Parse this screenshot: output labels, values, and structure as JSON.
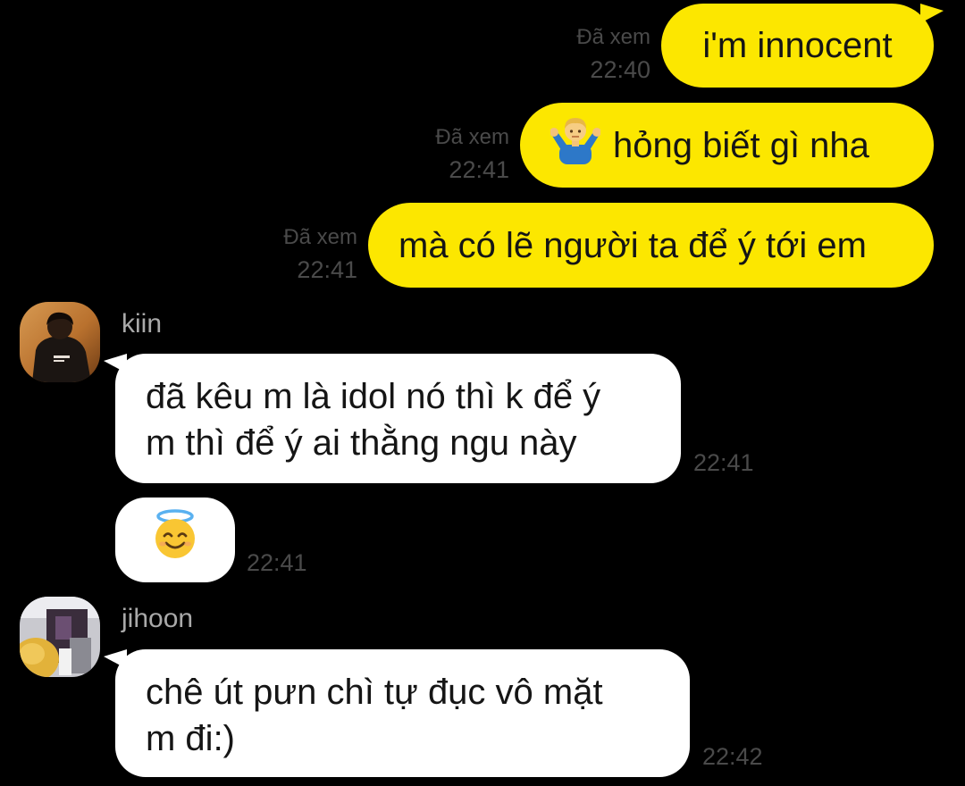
{
  "outgoing": [
    {
      "seen": "Đã xem",
      "time": "22:40",
      "text": "i'm innocent"
    },
    {
      "seen": "Đã xem",
      "time": "22:41",
      "text": "hỏng biết gì nha",
      "emoji": "person-shrugging-icon"
    },
    {
      "seen": "Đã xem",
      "time": "22:41",
      "text": "mà có lẽ người ta để ý tới em"
    }
  ],
  "kiin": {
    "name": "kiin",
    "message_line1": "đã kêu m là idol nó thì k để ý",
    "message_line2": "m thì để ý ai thằng ngu này",
    "message_time": "22:41",
    "emoji": "smiling-face-with-halo-icon",
    "emoji_time": "22:41"
  },
  "jihoon": {
    "name": "jihoon",
    "message_line1": "chê út pưn chì tự đục vô mặt",
    "message_line2": "m đi:)",
    "message_time": "22:42"
  },
  "colors": {
    "background": "#000000",
    "outgoing_bubble": "#fce700",
    "incoming_bubble": "#ffffff",
    "meta_text": "#4a4a4a",
    "sender_name": "#a9a9a9"
  }
}
